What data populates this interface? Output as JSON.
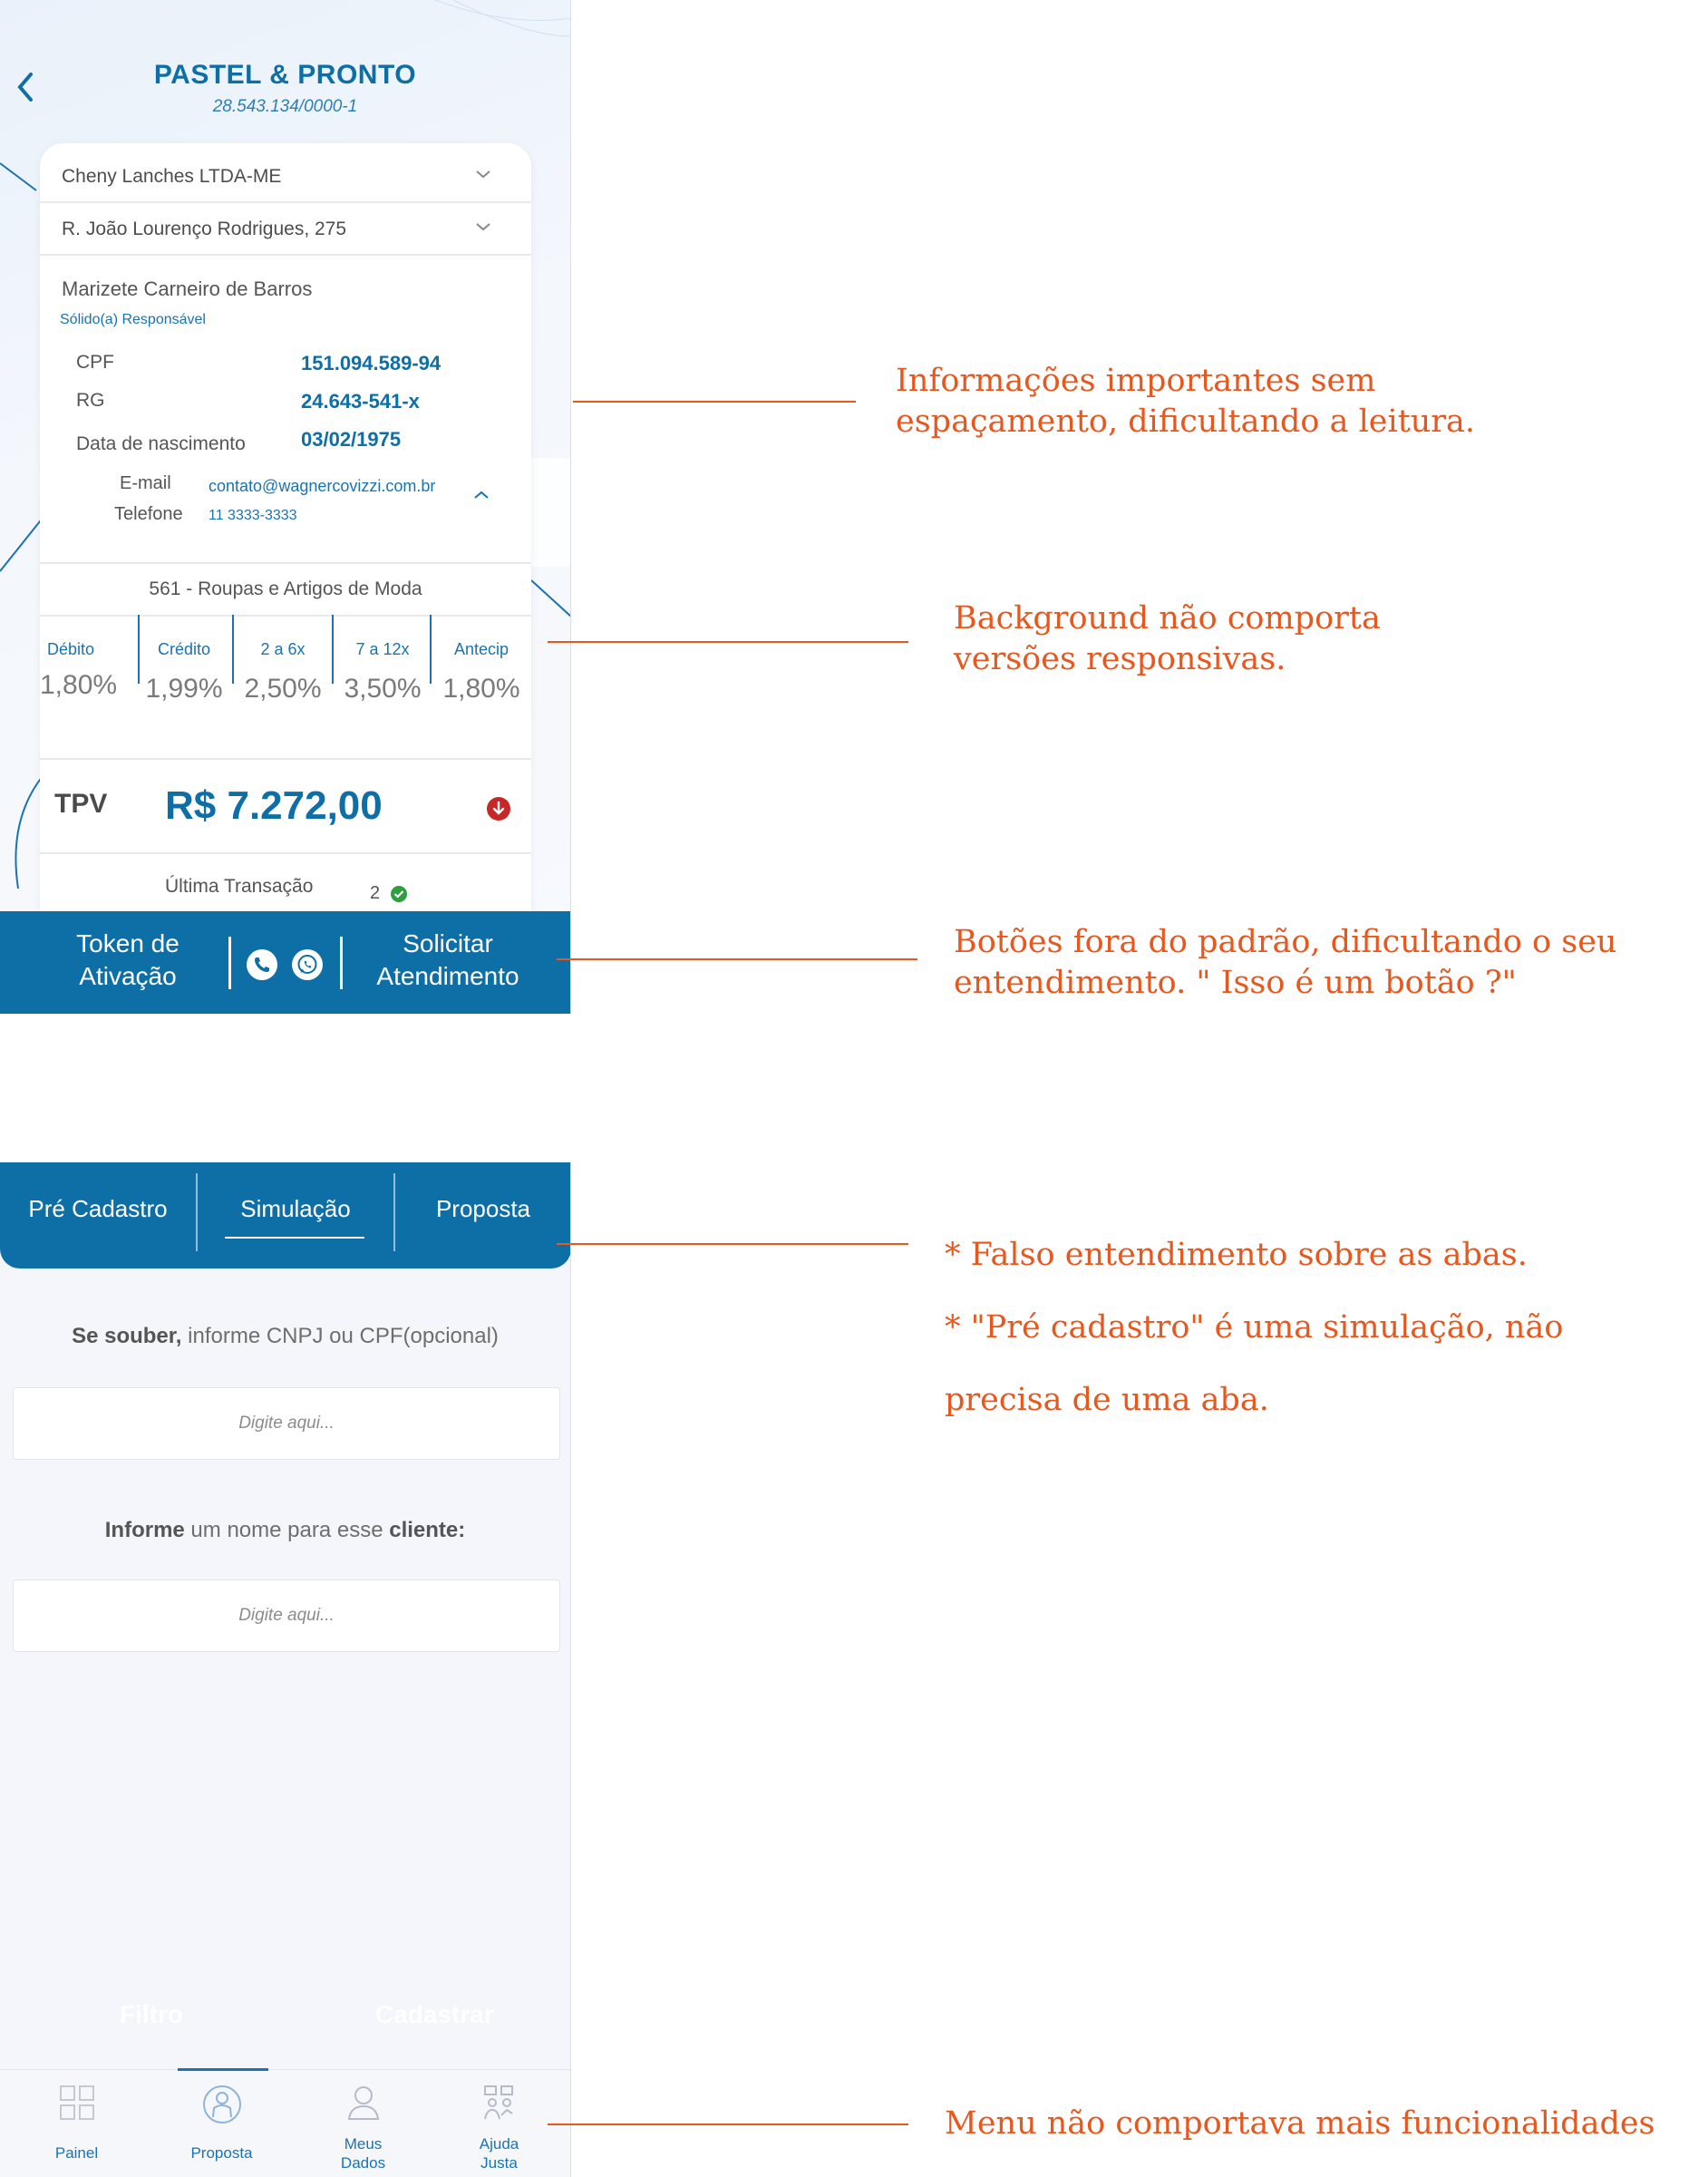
{
  "screen1": {
    "company_name": "PASTEL & PRONTO",
    "company_cnpj": "28.543.134/0000-1",
    "dropdown_company": "Cheny Lanches LTDA-ME",
    "dropdown_address": "R. João Lourenço Rodrigues, 275",
    "person": {
      "name": "Marizete Carneiro de Barros",
      "role": "Sólido(a) Responsável",
      "cpf_label": "CPF",
      "cpf_value": "151.094.589-94",
      "rg_label": "RG",
      "rg_value": "24.643-541-x",
      "birth_label": "Data de nascimento",
      "birth_value": "03/02/1975",
      "email_label": "E-mail",
      "email_value": "contato@wagnercovizzi.com.br",
      "phone_label": "Telefone",
      "phone_value": "11 3333-3333"
    },
    "segment": "561 - Roupas e Artigos de Moda",
    "rates": [
      {
        "label": "Débito",
        "value": "1,80%"
      },
      {
        "label": "Crédito",
        "value": "1,99%"
      },
      {
        "label": "2 a 6x",
        "value": "2,50%"
      },
      {
        "label": "7 a 12x",
        "value": "3,50%"
      },
      {
        "label": "Antecip",
        "value": "1,80%"
      }
    ],
    "tpv_label": "TPV",
    "tpv_value": "R$ 7.272,00",
    "last_transaction_label": "Última Transação",
    "last_transaction_count": "2",
    "bottom_bar": {
      "token_line1": "Token de",
      "token_line2": "Ativação",
      "solicitar_line1": "Solicitar",
      "solicitar_line2": "Atendimento"
    }
  },
  "screen2": {
    "tabs": [
      "Pré Cadastro",
      "Simulação",
      "Proposta"
    ],
    "active_tab": "Simulação",
    "field1": {
      "label_bold": "Se souber,",
      "label_rest": " informe CNPJ ou CPF(opcional)",
      "placeholder": "Digite aqui..."
    },
    "field2": {
      "label_bold1": "Informe",
      "label_mid": " um nome para esse ",
      "label_bold2": "cliente:",
      "placeholder": "Digite aqui..."
    },
    "ghost_buttons": [
      "Filtro",
      "Cadastrar"
    ],
    "nav": {
      "painel": "Painel",
      "proposta": "Proposta",
      "meus_line1": "Meus",
      "meus_line2": "Dados",
      "ajuda_line1": "Ajuda",
      "ajuda_line2": "Justa"
    }
  },
  "annotations": {
    "a1_line1": "Informações importantes sem",
    "a1_line2": "espaçamento, dificultando a leitura.",
    "a2_line1": "Background não comporta",
    "a2_line2": "versões responsivas.",
    "a3_line1": "Botões fora do padrão, dificultando o seu",
    "a3_line2": "entendimento. \" Isso é um botão ?\"",
    "a4_line1": "* Falso entendimento sobre as abas.",
    "a4_line2": "* \"Pré cadastro\" é uma simulação, não",
    "a4_line3": "precisa de uma aba.",
    "a5_line1": "Menu não comportava mais funcionalidades"
  },
  "colors": {
    "brand_blue": "#0e6fa6",
    "annotation_orange": "#e8571d",
    "alert_red": "#c62828",
    "ok_green": "#2e9e3f"
  }
}
